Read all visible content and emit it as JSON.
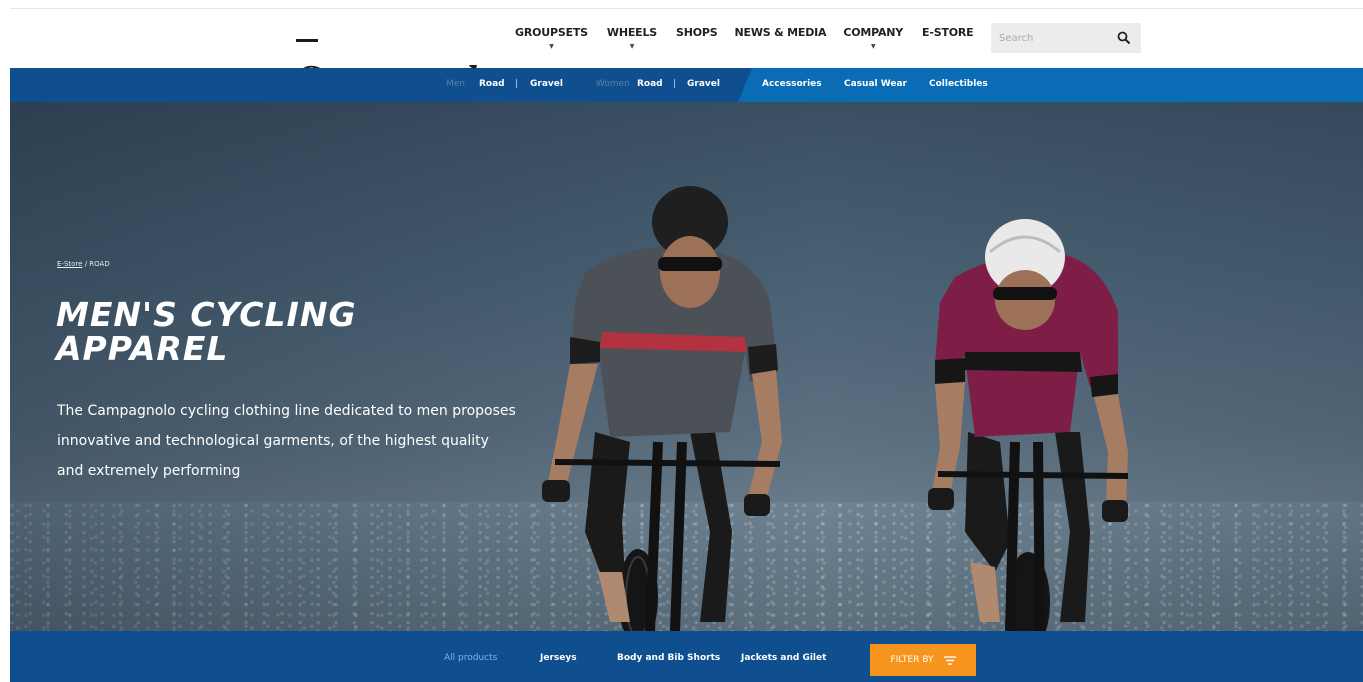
{
  "header": {
    "logo_text": "Campagnolo",
    "nav": [
      {
        "label": "GROUPSETS",
        "has_dropdown": true
      },
      {
        "label": "WHEELS",
        "has_dropdown": true
      },
      {
        "label": "SHOPS",
        "has_dropdown": false
      },
      {
        "label": "NEWS & MEDIA",
        "has_dropdown": false
      },
      {
        "label": "COMPANY",
        "has_dropdown": true
      },
      {
        "label": "E-STORE",
        "has_dropdown": false
      }
    ],
    "search_placeholder": "Search",
    "search_icon": "search-icon"
  },
  "sub_nav": {
    "men_label": "Men",
    "men_road": "Road",
    "men_sep": "|",
    "men_gravel": "Gravel",
    "women_label": "Women",
    "women_road": "Road",
    "women_sep": "|",
    "women_gravel": "Gravel",
    "accessories": "Accessories",
    "casual_wear": "Casual Wear",
    "collectibles": "Collectibles"
  },
  "hero": {
    "breadcrumb_link": "E-Store",
    "breadcrumb_sep": "/",
    "breadcrumb_current": "ROAD",
    "title_line1": "MEN'S CYCLING",
    "title_line2": "APPAREL",
    "desc_line1": "The Campagnolo cycling clothing line dedicated to men proposes",
    "desc_line2": "innovative and technological garments, of the highest quality",
    "desc_line3": "and extremely performing"
  },
  "filter_bar": {
    "categories": [
      "All products",
      "Jerseys",
      "Body and Bib Shorts",
      "Jackets and Gilet"
    ],
    "active_category": "All products",
    "filter_button": "FILTER BY",
    "filter_icon": "filter-lines-icon"
  },
  "colors": {
    "nav_blue": "#0f4f8f",
    "accent_blue": "#0a6cb4",
    "filter_orange": "#f7941d"
  }
}
